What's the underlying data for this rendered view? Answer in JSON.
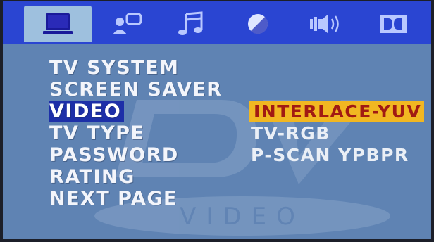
{
  "tabs": [
    {
      "icon": "tv-monitor-icon",
      "active": true
    },
    {
      "icon": "person-speech-icon",
      "active": false
    },
    {
      "icon": "music-note-icon",
      "active": false
    },
    {
      "icon": "color-contrast-icon",
      "active": false
    },
    {
      "icon": "speaker-sound-icon",
      "active": false
    },
    {
      "icon": "dolby-icon",
      "active": false
    }
  ],
  "menu": {
    "items": [
      {
        "label": "TV SYSTEM"
      },
      {
        "label": "SCREEN SAVER"
      },
      {
        "label": "VIDEO"
      },
      {
        "label": "TV TYPE"
      },
      {
        "label": "PASSWORD"
      },
      {
        "label": "RATING"
      },
      {
        "label": "NEXT PAGE"
      }
    ],
    "selected_index": 2
  },
  "options": {
    "items": [
      {
        "label": "INTERLACE-YUV"
      },
      {
        "label": "TV-RGB"
      },
      {
        "label": "P-SCAN YPBPR"
      }
    ],
    "highlighted_index": 0
  },
  "watermark": {
    "logo_text": "DVD",
    "sub_text": "VIDEO"
  },
  "colors": {
    "panel_bg": "#5f83b3",
    "tabbar_bg": "#2a45d2",
    "active_tab_bg": "#9ec0de",
    "selection_bg": "#1d2fa8",
    "highlight_bg": "#f1b722",
    "highlight_text": "#a11a13"
  }
}
